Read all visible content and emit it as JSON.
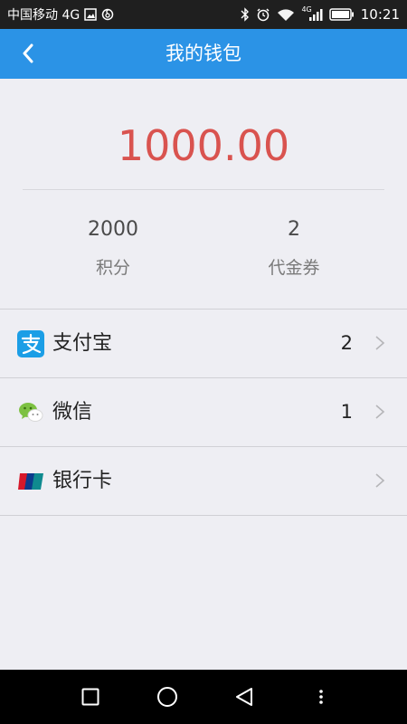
{
  "status_bar": {
    "carrier": "中国移动 4G",
    "network_tag": "4G",
    "time": "10:21"
  },
  "header": {
    "title": "我的钱包",
    "back_icon": "chevron-left-icon"
  },
  "wallet": {
    "balance": "1000.00",
    "balance_color": "#d9534f",
    "stats": [
      {
        "value": "2000",
        "label": "积分"
      },
      {
        "value": "2",
        "label": "代金券"
      }
    ]
  },
  "payment_methods": [
    {
      "label": "支付宝",
      "count": "2",
      "icon": "alipay-icon"
    },
    {
      "label": "微信",
      "count": "1",
      "icon": "wechat-icon"
    },
    {
      "label": "银行卡",
      "count": "",
      "icon": "unionpay-icon"
    }
  ],
  "colors": {
    "nav_blue": "#2b93e6",
    "background": "#eeeef3"
  }
}
